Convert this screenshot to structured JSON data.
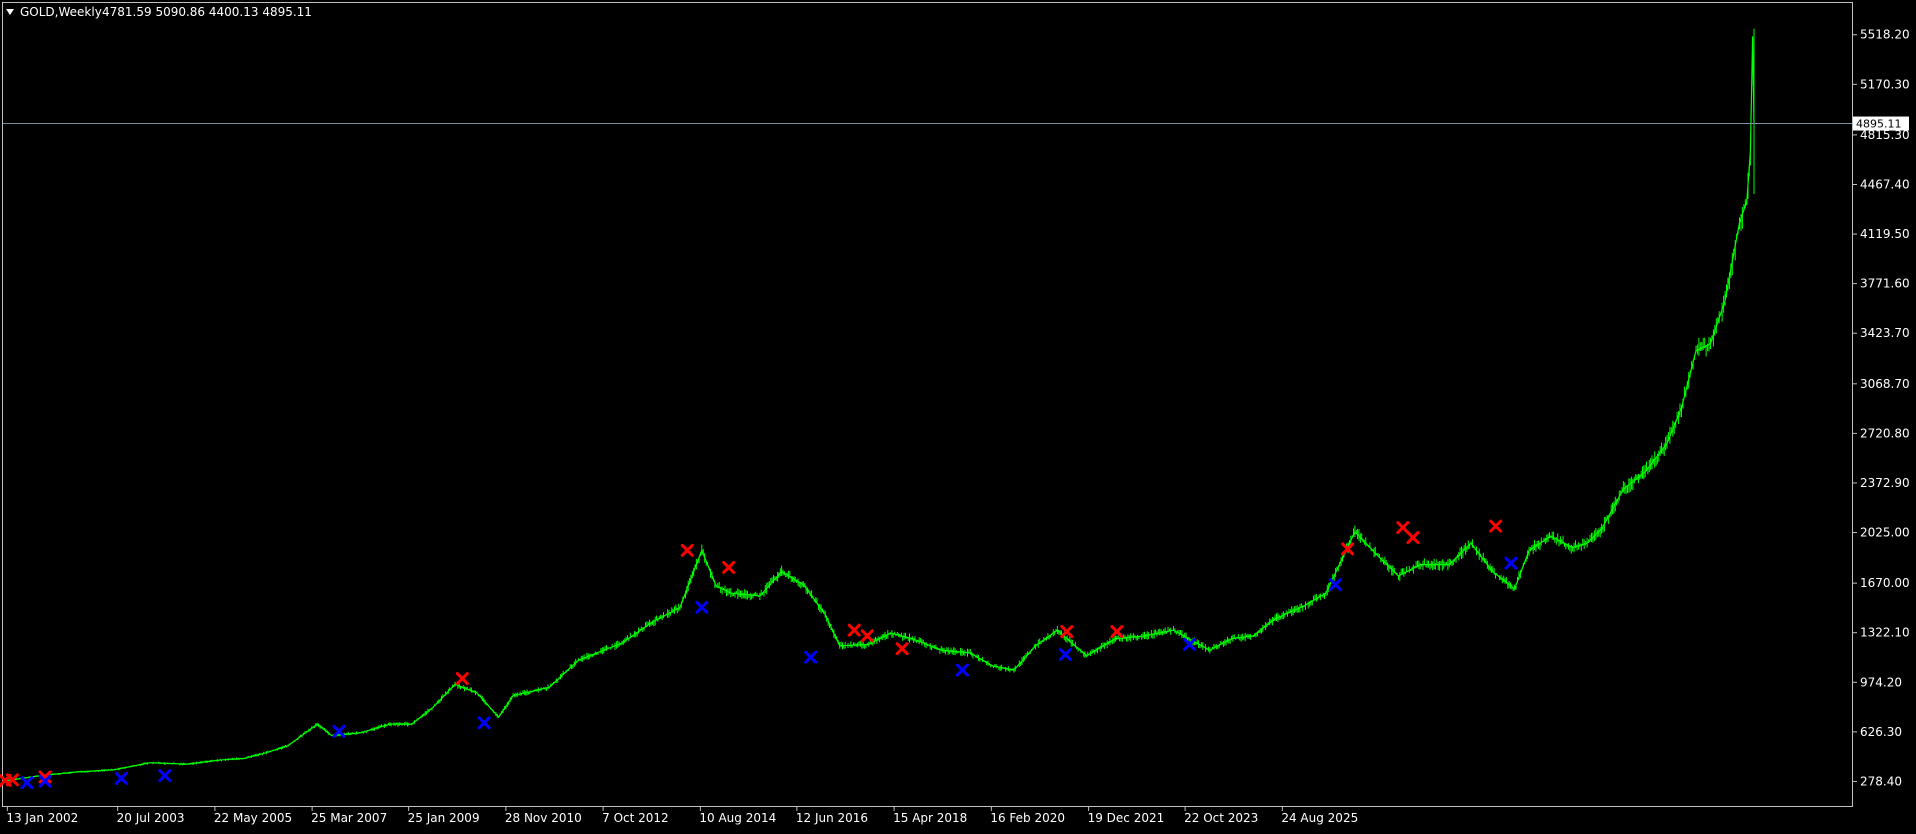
{
  "header": {
    "symbol_label": "GOLD,Weekly",
    "ohlc_label": "4781.59 5090.86 4400.13 4895.11"
  },
  "price_marker": {
    "value_label": "4895.11"
  },
  "colors": {
    "background": "#000000",
    "frame": "#c0c0c0",
    "price_line": "#00ff00",
    "sell_marker": "#ff0000",
    "buy_marker": "#0000ff",
    "current_price_line": "#7f8c9c",
    "text": "#ffffff"
  },
  "chart_data": {
    "type": "line",
    "title": "",
    "xlabel": "",
    "ylabel": "",
    "grid": false,
    "xlim": [
      2001.97,
      2027.45
    ],
    "ylim": [
      106,
      5741
    ],
    "y_ticks": [
      "5518.20",
      "5170.30",
      "4815.30",
      "4467.40",
      "4119.50",
      "3771.60",
      "3423.70",
      "3068.70",
      "2720.80",
      "2372.90",
      "2025.00",
      "1670.00",
      "1322.10",
      "974.20",
      "626.30",
      "278.40"
    ],
    "x_ticks": [
      "13 Jan 2002",
      "20 Jul 2003",
      "22 May 2005",
      "25 Mar 2007",
      "25 Jan 2009",
      "28 Nov 2010",
      "7 Oct 2012",
      "10 Aug 2014",
      "12 Jun 2016",
      "15 Apr 2018",
      "16 Feb 2020",
      "19 Dec 2021",
      "22 Oct 2023",
      "24 Aug 2025"
    ],
    "x_tick_years": [
      2002.03,
      2003.55,
      2004.89,
      2006.23,
      2007.56,
      2008.9,
      2010.24,
      2011.58,
      2012.91,
      2014.25,
      2015.59,
      2016.93,
      2018.26,
      2019.6
    ],
    "series": [
      {
        "values": [
          [
            2001.97,
            280
          ],
          [
            2002.5,
            320
          ],
          [
            2003.0,
            345
          ],
          [
            2003.5,
            360
          ],
          [
            2004.0,
            410
          ],
          [
            2004.5,
            400
          ],
          [
            2005.0,
            430
          ],
          [
            2005.3,
            440
          ],
          [
            2005.6,
            480
          ],
          [
            2005.9,
            530
          ],
          [
            2006.3,
            680
          ],
          [
            2006.5,
            600
          ],
          [
            2006.9,
            620
          ],
          [
            2007.3,
            680
          ],
          [
            2007.6,
            680
          ],
          [
            2007.9,
            800
          ],
          [
            2008.2,
            960
          ],
          [
            2008.5,
            900
          ],
          [
            2008.8,
            730
          ],
          [
            2009.0,
            880
          ],
          [
            2009.5,
            940
          ],
          [
            2009.9,
            1130
          ],
          [
            2010.5,
            1250
          ],
          [
            2010.9,
            1390
          ],
          [
            2011.3,
            1500
          ],
          [
            2011.6,
            1900
          ],
          [
            2011.8,
            1650
          ],
          [
            2012.0,
            1600
          ],
          [
            2012.4,
            1580
          ],
          [
            2012.7,
            1750
          ],
          [
            2013.0,
            1660
          ],
          [
            2013.3,
            1450
          ],
          [
            2013.5,
            1230
          ],
          [
            2013.9,
            1240
          ],
          [
            2014.2,
            1320
          ],
          [
            2014.5,
            1280
          ],
          [
            2014.9,
            1200
          ],
          [
            2015.3,
            1180
          ],
          [
            2015.6,
            1090
          ],
          [
            2015.9,
            1060
          ],
          [
            2016.2,
            1230
          ],
          [
            2016.5,
            1340
          ],
          [
            2016.9,
            1160
          ],
          [
            2017.3,
            1280
          ],
          [
            2017.7,
            1300
          ],
          [
            2018.1,
            1340
          ],
          [
            2018.6,
            1200
          ],
          [
            2018.9,
            1280
          ],
          [
            2019.2,
            1300
          ],
          [
            2019.5,
            1420
          ],
          [
            2019.9,
            1510
          ],
          [
            2020.2,
            1600
          ],
          [
            2020.6,
            2030
          ],
          [
            2020.9,
            1870
          ],
          [
            2021.2,
            1720
          ],
          [
            2021.5,
            1800
          ],
          [
            2021.9,
            1800
          ],
          [
            2022.2,
            1950
          ],
          [
            2022.5,
            1750
          ],
          [
            2022.8,
            1630
          ],
          [
            2023.0,
            1900
          ],
          [
            2023.3,
            2000
          ],
          [
            2023.6,
            1920
          ],
          [
            2023.8,
            1950
          ],
          [
            2024.0,
            2050
          ],
          [
            2024.3,
            2330
          ],
          [
            2024.6,
            2450
          ],
          [
            2024.9,
            2650
          ],
          [
            2025.1,
            2900
          ],
          [
            2025.3,
            3300
          ],
          [
            2025.5,
            3350
          ],
          [
            2025.7,
            3650
          ],
          [
            2025.9,
            4200
          ],
          [
            2026.0,
            4350
          ],
          [
            2026.05,
            4700
          ],
          [
            2026.08,
            5500
          ],
          [
            2026.1,
            4895
          ]
        ]
      }
    ],
    "sell_signals": [
      [
        2002.0,
        285
      ],
      [
        2002.1,
        290
      ],
      [
        2002.55,
        310
      ],
      [
        2008.3,
        1000
      ],
      [
        2011.4,
        1900
      ],
      [
        2011.97,
        1780
      ],
      [
        2013.7,
        1340
      ],
      [
        2013.88,
        1300
      ],
      [
        2014.36,
        1210
      ],
      [
        2016.63,
        1330
      ],
      [
        2017.32,
        1330
      ],
      [
        2020.5,
        1910
      ],
      [
        2021.26,
        2060
      ],
      [
        2021.4,
        1990
      ],
      [
        2022.54,
        2070
      ]
    ],
    "buy_signals": [
      [
        2002.3,
        270
      ],
      [
        2002.55,
        280
      ],
      [
        2003.6,
        300
      ],
      [
        2004.2,
        320
      ],
      [
        2006.6,
        630
      ],
      [
        2008.6,
        690
      ],
      [
        2011.6,
        1500
      ],
      [
        2013.1,
        1150
      ],
      [
        2015.19,
        1060
      ],
      [
        2016.61,
        1170
      ],
      [
        2018.32,
        1240
      ],
      [
        2020.33,
        1660
      ],
      [
        2022.75,
        1810
      ]
    ]
  }
}
